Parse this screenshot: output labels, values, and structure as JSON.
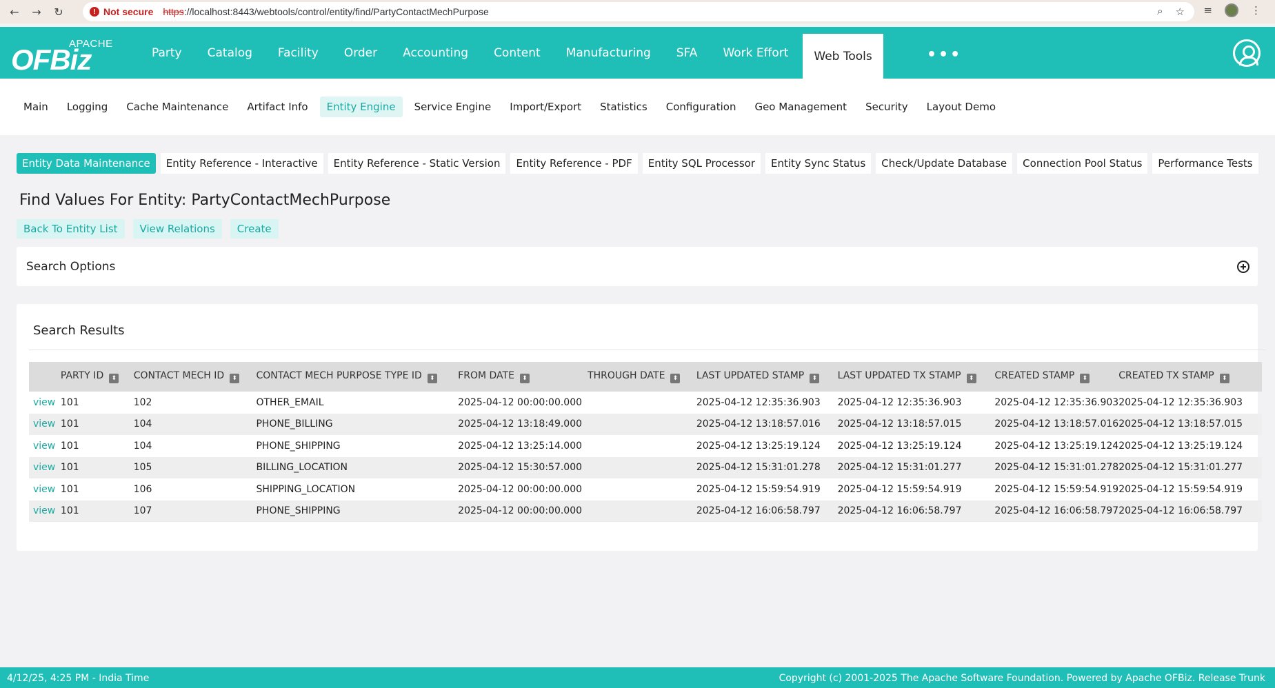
{
  "browser": {
    "not_secure": "Not secure",
    "url_scheme": "https",
    "url_rest": "://localhost:8443/webtools/control/entity/find/PartyContactMechPurpose"
  },
  "app": {
    "logo_apache": "APACHE",
    "logo_ofbiz": "OFBiz",
    "nav": [
      "Party",
      "Catalog",
      "Facility",
      "Order",
      "Accounting",
      "Content",
      "Manufacturing",
      "SFA",
      "Work Effort"
    ],
    "active_nav": "Web Tools",
    "more": "•••"
  },
  "submenu": {
    "items": [
      "Main",
      "Logging",
      "Cache Maintenance",
      "Artifact Info",
      "Entity Engine",
      "Service Engine",
      "Import/Export",
      "Statistics",
      "Configuration",
      "Geo Management",
      "Security",
      "Layout Demo"
    ],
    "active_index": 4
  },
  "tabs": {
    "items": [
      "Entity Data Maintenance",
      "Entity Reference - Interactive",
      "Entity Reference - Static Version",
      "Entity Reference - PDF",
      "Entity SQL Processor",
      "Entity Sync Status",
      "Check/Update Database",
      "Connection Pool Status",
      "Performance Tests"
    ],
    "active_index": 0
  },
  "page": {
    "title": "Find Values For Entity: PartyContactMechPurpose",
    "actions": [
      "Back To Entity List",
      "View Relations",
      "Create"
    ],
    "search_options_label": "Search Options",
    "search_results_label": "Search Results"
  },
  "table": {
    "columns": [
      "",
      "PARTY ID",
      "CONTACT MECH ID",
      "CONTACT MECH PURPOSE TYPE ID",
      "FROM DATE",
      "THROUGH DATE",
      "LAST UPDATED STAMP",
      "LAST UPDATED TX STAMP",
      "CREATED STAMP",
      "CREATED TX STAMP"
    ],
    "rows": [
      [
        "view",
        "101",
        "102",
        "OTHER_EMAIL",
        "2025-04-12 00:00:00.000",
        "",
        "2025-04-12 12:35:36.903",
        "2025-04-12 12:35:36.903",
        "2025-04-12 12:35:36.903",
        "2025-04-12 12:35:36.903"
      ],
      [
        "view",
        "101",
        "104",
        "PHONE_BILLING",
        "2025-04-12 13:18:49.000",
        "",
        "2025-04-12 13:18:57.016",
        "2025-04-12 13:18:57.015",
        "2025-04-12 13:18:57.016",
        "2025-04-12 13:18:57.015"
      ],
      [
        "view",
        "101",
        "104",
        "PHONE_SHIPPING",
        "2025-04-12 13:25:14.000",
        "",
        "2025-04-12 13:25:19.124",
        "2025-04-12 13:25:19.124",
        "2025-04-12 13:25:19.124",
        "2025-04-12 13:25:19.124"
      ],
      [
        "view",
        "101",
        "105",
        "BILLING_LOCATION",
        "2025-04-12 15:30:57.000",
        "",
        "2025-04-12 15:31:01.278",
        "2025-04-12 15:31:01.277",
        "2025-04-12 15:31:01.278",
        "2025-04-12 15:31:01.277"
      ],
      [
        "view",
        "101",
        "106",
        "SHIPPING_LOCATION",
        "2025-04-12 00:00:00.000",
        "",
        "2025-04-12 15:59:54.919",
        "2025-04-12 15:59:54.919",
        "2025-04-12 15:59:54.919",
        "2025-04-12 15:59:54.919"
      ],
      [
        "view",
        "101",
        "107",
        "PHONE_SHIPPING",
        "2025-04-12 00:00:00.000",
        "",
        "2025-04-12 16:06:58.797",
        "2025-04-12 16:06:58.797",
        "2025-04-12 16:06:58.797",
        "2025-04-12 16:06:58.797"
      ]
    ]
  },
  "footer": {
    "left": "4/12/25, 4:25 PM - India Time",
    "right": "Copyright (c) 2001-2025 The Apache Software Foundation. Powered by Apache OFBiz. Release Trunk"
  },
  "colors": {
    "accent": "#1fbfb8",
    "accent_light": "#d8f5f3",
    "link": "#1aa9a2"
  },
  "icons": {
    "back": "arrow-left-icon",
    "forward": "arrow-right-icon",
    "reload": "reload-icon",
    "zoom": "zoom-icon",
    "bookmark": "star-icon",
    "user": "user-circle-icon",
    "expand": "plus-circle-icon",
    "sort": "sort-icon"
  }
}
